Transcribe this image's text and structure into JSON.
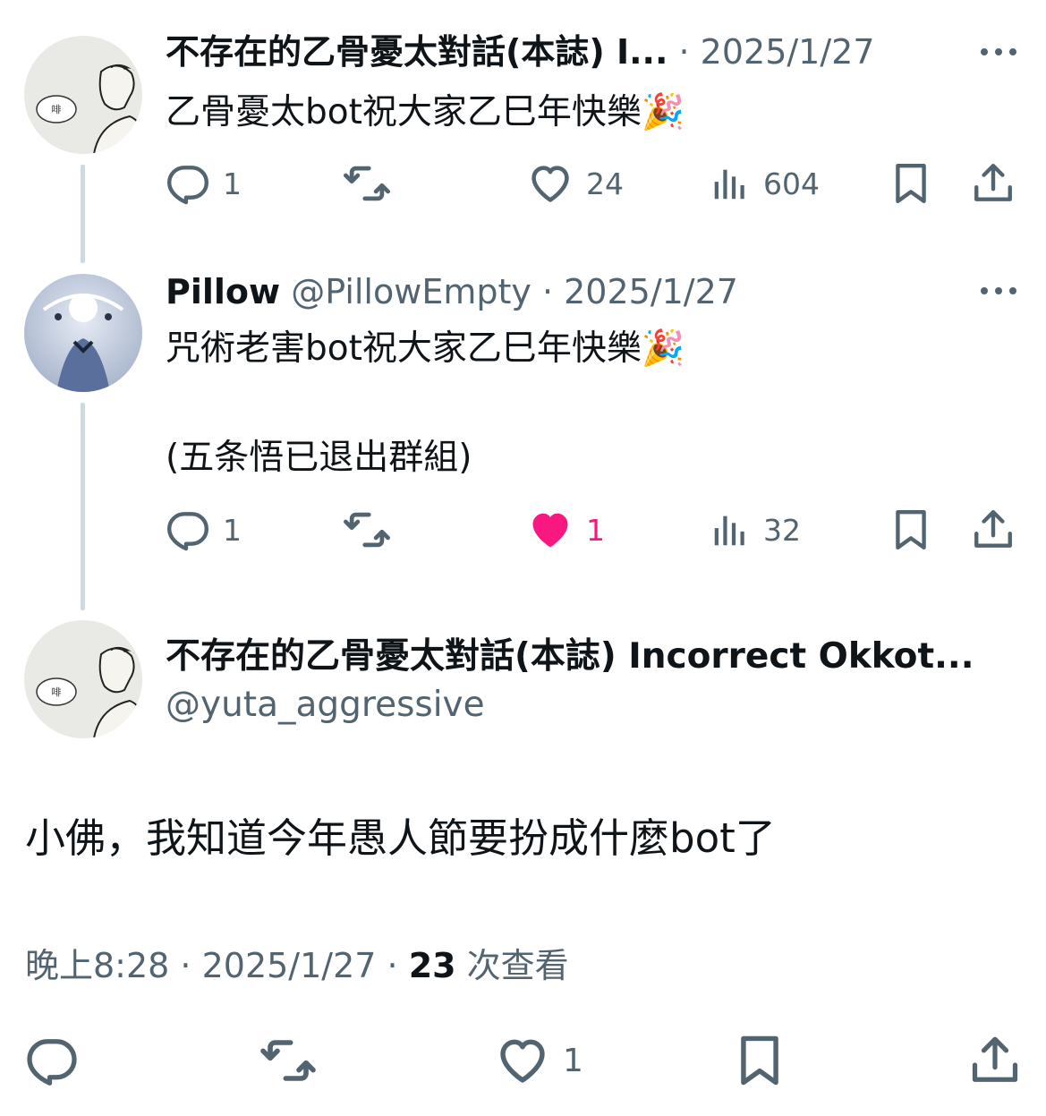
{
  "tweet1": {
    "name": "不存在的乙骨憂太對話(本誌) I...",
    "sep": " · ",
    "date": "2025/1/27",
    "text": "乙骨憂太bot祝大家乙巳年快樂🎉",
    "counts": {
      "reply": "1",
      "like": "24",
      "views": "604"
    }
  },
  "tweet2": {
    "name": "Pillow",
    "handle": "@PillowEmpty",
    "sep": " · ",
    "date": "2025/1/27",
    "text_line1": "咒術老害bot祝大家乙巳年快樂🎉",
    "text_line2": "(五条悟已退出群組)",
    "counts": {
      "reply": "1",
      "like": "1",
      "views": "32"
    },
    "liked": true
  },
  "main": {
    "name": "不存在的乙骨憂太對話(本誌) Incorrect Okkot...",
    "handle": "@yuta_aggressive",
    "text": "小佛，我知道今年愚人節要扮成什麼bot了",
    "time": "晚上8:28",
    "sep": " · ",
    "date": "2025/1/27",
    "views_count": "23",
    "views_label": " 次查看",
    "like_count": "1"
  },
  "colors": {
    "text": "#0f1419",
    "muted": "#536471",
    "like": "#f91880",
    "line": "#cfd9de"
  },
  "icons": [
    "reply-icon",
    "retweet-icon",
    "like-icon",
    "views-icon",
    "bookmark-icon",
    "share-icon",
    "more-icon"
  ]
}
